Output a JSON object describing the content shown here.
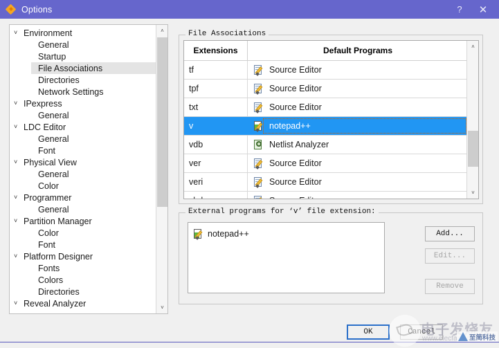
{
  "window": {
    "title": "Options",
    "icon": "diamond-icon",
    "help_label": "?",
    "close_label": "✕",
    "titlebar_color": "#6666cc"
  },
  "sidebar": {
    "scroll": {
      "up_arrow": "˄",
      "down_arrow": "˅"
    },
    "items": [
      {
        "label": "Environment",
        "level": 0,
        "expanded": true,
        "chevron": "˅",
        "selected": false
      },
      {
        "label": "General",
        "level": 1,
        "expanded": false,
        "chevron": "",
        "selected": false
      },
      {
        "label": "Startup",
        "level": 1,
        "expanded": false,
        "chevron": "",
        "selected": false
      },
      {
        "label": "File Associations",
        "level": 1,
        "expanded": false,
        "chevron": "",
        "selected": true
      },
      {
        "label": "Directories",
        "level": 1,
        "expanded": false,
        "chevron": "",
        "selected": false
      },
      {
        "label": "Network Settings",
        "level": 1,
        "expanded": false,
        "chevron": "",
        "selected": false
      },
      {
        "label": "IPexpress",
        "level": 0,
        "expanded": true,
        "chevron": "˅",
        "selected": false
      },
      {
        "label": "General",
        "level": 1,
        "expanded": false,
        "chevron": "",
        "selected": false
      },
      {
        "label": "LDC Editor",
        "level": 0,
        "expanded": true,
        "chevron": "˅",
        "selected": false
      },
      {
        "label": "General",
        "level": 1,
        "expanded": false,
        "chevron": "",
        "selected": false
      },
      {
        "label": "Font",
        "level": 1,
        "expanded": false,
        "chevron": "",
        "selected": false
      },
      {
        "label": "Physical View",
        "level": 0,
        "expanded": true,
        "chevron": "˅",
        "selected": false
      },
      {
        "label": "General",
        "level": 1,
        "expanded": false,
        "chevron": "",
        "selected": false
      },
      {
        "label": "Color",
        "level": 1,
        "expanded": false,
        "chevron": "",
        "selected": false
      },
      {
        "label": "Programmer",
        "level": 0,
        "expanded": true,
        "chevron": "˅",
        "selected": false
      },
      {
        "label": "General",
        "level": 1,
        "expanded": false,
        "chevron": "",
        "selected": false
      },
      {
        "label": "Partition Manager",
        "level": 0,
        "expanded": true,
        "chevron": "˅",
        "selected": false
      },
      {
        "label": "Color",
        "level": 1,
        "expanded": false,
        "chevron": "",
        "selected": false
      },
      {
        "label": "Font",
        "level": 1,
        "expanded": false,
        "chevron": "",
        "selected": false
      },
      {
        "label": "Platform Designer",
        "level": 0,
        "expanded": true,
        "chevron": "˅",
        "selected": false
      },
      {
        "label": "Fonts",
        "level": 1,
        "expanded": false,
        "chevron": "",
        "selected": false
      },
      {
        "label": "Colors",
        "level": 1,
        "expanded": false,
        "chevron": "",
        "selected": false
      },
      {
        "label": "Directories",
        "level": 1,
        "expanded": false,
        "chevron": "",
        "selected": false
      },
      {
        "label": "Reveal Analyzer",
        "level": 0,
        "expanded": true,
        "chevron": "˅",
        "selected": false
      }
    ]
  },
  "assoc_group": {
    "title": "File Associations",
    "columns": [
      "Extensions",
      "Default Programs"
    ],
    "rows": [
      {
        "ext": "tf",
        "program": "Source Editor",
        "icon": "source-editor-icon",
        "selected": false
      },
      {
        "ext": "tpf",
        "program": "Source Editor",
        "icon": "source-editor-icon",
        "selected": false
      },
      {
        "ext": "txt",
        "program": "Source Editor",
        "icon": "source-editor-icon",
        "selected": false
      },
      {
        "ext": "v",
        "program": "notepad++",
        "icon": "notepad-plus-icon",
        "selected": true
      },
      {
        "ext": "vdb",
        "program": "Netlist Analyzer",
        "icon": "netlist-analyzer-icon",
        "selected": false
      },
      {
        "ext": "ver",
        "program": "Source Editor",
        "icon": "source-editor-icon",
        "selected": false
      },
      {
        "ext": "veri",
        "program": "Source Editor",
        "icon": "source-editor-icon",
        "selected": false
      },
      {
        "ext": "vhd",
        "program": "Source Editor",
        "icon": "source-editor-icon",
        "selected": false
      }
    ],
    "selection_color": "#2196f3",
    "scroll": {
      "up_arrow": "˄",
      "down_arrow": "˅"
    }
  },
  "extprog_group": {
    "title": "External programs for ‘v’ file extension:",
    "items": [
      {
        "label": "notepad++",
        "icon": "notepad-plus-icon"
      }
    ],
    "buttons": [
      {
        "label": "Add...",
        "enabled": true
      },
      {
        "label": "Edit...",
        "enabled": false
      },
      {
        "label": "Remove",
        "enabled": false
      }
    ]
  },
  "footer": {
    "ok_label": "OK",
    "cancel_label": "Cancel"
  },
  "watermark": {
    "cn_text": "电子发烧友",
    "url_text": "www.elecfans.com",
    "badge_text": "至简科技"
  }
}
